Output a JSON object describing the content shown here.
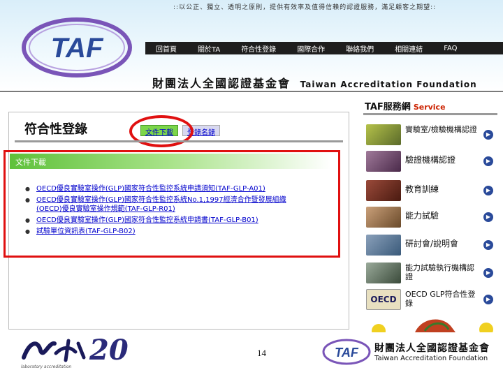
{
  "header": {
    "slogan": "::以公正、獨立、透明之原則，提供有效率及值得信賴的認證服務，滿足顧客之期望::",
    "logo_text": "TAF",
    "nav": [
      "回首頁",
      "關於TA",
      "符合性登錄",
      "國際合作",
      "聯絡我們",
      "相關連結",
      "FAQ"
    ],
    "org_name_zh": "財團法人全國認證基金會",
    "org_name_en": "Taiwan Accreditation Foundation"
  },
  "main": {
    "title": "符合性登錄",
    "tabs": [
      {
        "label": "文件下載",
        "active": true
      },
      {
        "label": "登錄名錄",
        "active": false
      }
    ],
    "section_title": "文件下載",
    "documents": [
      {
        "text": "OECD優良實驗室操作(GLP)國家符合性監控系統申請須知(TAF-GLP-A01)"
      },
      {
        "text": "OECD優良實驗室操作(GLP)國家符合性監控系統No.1,1997經濟合作暨發展組織",
        "cont": "(OECD)優良實驗室操作規範(TAF-GLP-R01)"
      },
      {
        "text": "OECD優良實驗室操作(GLP)國家符合性監控系統申請書(TAF-GLP-B01)"
      },
      {
        "text": "試驗單位資訊表(TAF-GLP-B02)"
      }
    ]
  },
  "sidebar": {
    "title": "TAF服務網",
    "subtitle": "Service",
    "items": [
      {
        "label": "實驗室/檢驗機構認證",
        "color": "#8a9a3a"
      },
      {
        "label": "驗證機構認證",
        "color": "#7a4a6a"
      },
      {
        "label": "教育訓練",
        "color": "#7a3a2a"
      },
      {
        "label": "能力試驗",
        "color": "#9a6a4a"
      },
      {
        "label": "研討會/說明會",
        "color": "#5a7a9a"
      },
      {
        "label": "能力試驗執行機構認證",
        "color": "#6a7a6a"
      },
      {
        "label": "OECD GLP符合性登錄",
        "thumb_text": "OECD",
        "color": "#e8e0c0"
      }
    ]
  },
  "footer": {
    "left_logo_20": "20",
    "left_sub": "laboratory accreditation",
    "page_number": "14",
    "right_zh": "財團法人全國認證基金會",
    "right_en": "Taiwan Accreditation Foundation"
  },
  "colors": {
    "accent_red": "#e01010",
    "active_tab": "#7cd64a",
    "link": "#0000cc",
    "nav_bg": "#1e1e1e",
    "logo_purple": "#7a55b8",
    "logo_blue": "#2a4a9a"
  }
}
